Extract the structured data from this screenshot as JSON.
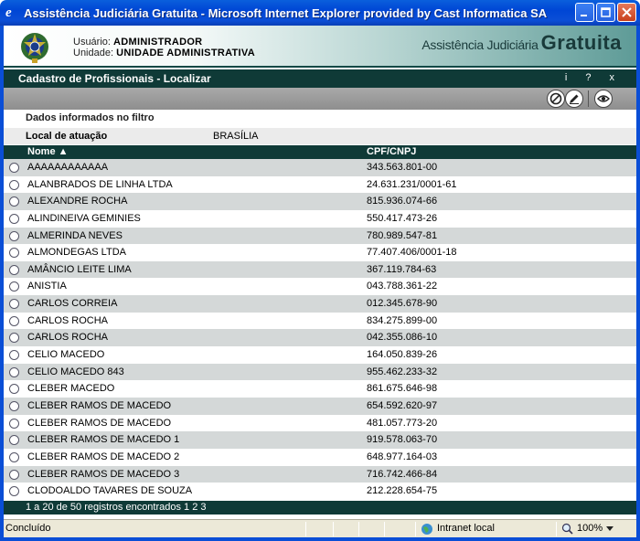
{
  "window": {
    "title": "Assistência Judiciária Gratuita - Microsoft Internet Explorer provided by Cast Informatica SA"
  },
  "header": {
    "user_label": "Usuário:",
    "user_value": "ADMINISTRADOR",
    "unit_label": "Unidade:",
    "unit_value": "UNIDADE ADMINISTRATIVA",
    "brand_part1": "Assistência Judiciária",
    "brand_part2": "Gratuita"
  },
  "pagebar": {
    "title": "Cadastro de Profissionais - Localizar",
    "info_label": "i",
    "help_label": "?",
    "close_label": "x"
  },
  "filter": {
    "heading": "Dados informados no filtro",
    "local_label": "Local de atuação",
    "local_value": "BRASÍLIA"
  },
  "table": {
    "col_name": "Nome ▲",
    "col_cpf": "CPF/CNPJ",
    "rows": [
      {
        "name": "AAAAAAAAAAAA",
        "cpf": "343.563.801-00"
      },
      {
        "name": "ALANBRADOS DE LINHA LTDA",
        "cpf": "24.631.231/0001-61"
      },
      {
        "name": "ALEXANDRE ROCHA",
        "cpf": "815.936.074-66"
      },
      {
        "name": "ALINDINEIVA GEMINIES",
        "cpf": "550.417.473-26"
      },
      {
        "name": "ALMERINDA NEVES",
        "cpf": "780.989.547-81"
      },
      {
        "name": "ALMONDEGAS LTDA",
        "cpf": "77.407.406/0001-18"
      },
      {
        "name": "AMÂNCIO LEITE LIMA",
        "cpf": "367.119.784-63"
      },
      {
        "name": "ANISTIA",
        "cpf": "043.788.361-22"
      },
      {
        "name": "CARLOS CORREIA",
        "cpf": "012.345.678-90"
      },
      {
        "name": "CARLOS ROCHA",
        "cpf": "834.275.899-00"
      },
      {
        "name": "CARLOS ROCHA",
        "cpf": "042.355.086-10"
      },
      {
        "name": "CELIO MACEDO",
        "cpf": "164.050.839-26"
      },
      {
        "name": "CELIO MACEDO 843",
        "cpf": "955.462.233-32"
      },
      {
        "name": "CLEBER MACEDO",
        "cpf": "861.675.646-98"
      },
      {
        "name": "CLEBER RAMOS DE MACEDO",
        "cpf": "654.592.620-97"
      },
      {
        "name": "CLEBER RAMOS DE MACEDO",
        "cpf": "481.057.773-20"
      },
      {
        "name": "CLEBER RAMOS DE MACEDO 1",
        "cpf": "919.578.063-70"
      },
      {
        "name": "CLEBER RAMOS DE MACEDO 2",
        "cpf": "648.977.164-03"
      },
      {
        "name": "CLEBER RAMOS DE MACEDO 3",
        "cpf": "716.742.466-84"
      },
      {
        "name": "CLODOALDO TAVARES DE SOUZA",
        "cpf": "212.228.654-75"
      }
    ]
  },
  "footer": {
    "text": "1 a 20 de 50 registros encontrados 1 2 3"
  },
  "status": {
    "text": "Concluído",
    "zone": "Intranet local",
    "zoom": "100%"
  }
}
